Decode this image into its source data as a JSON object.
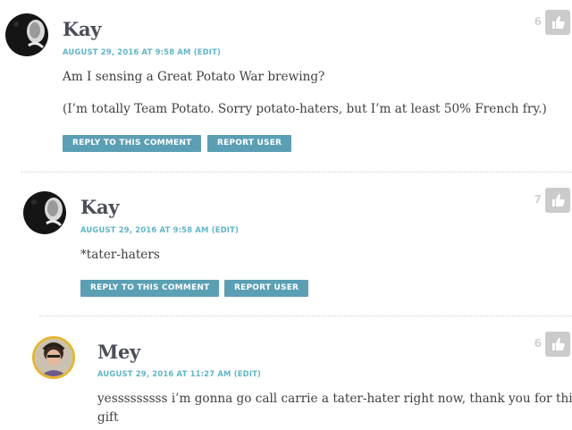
{
  "comments": [
    {
      "author": "Kay",
      "date": "AUGUST 29, 2016 AT 9:58 AM",
      "edit": "(EDIT)",
      "paragraphs": [
        "Am I sensing a Great Potato War brewing?",
        "(I’m totally Team Potato. Sorry potato-haters, but I’m at least 50% French fry.)"
      ],
      "reply_label": "REPLY TO THIS COMMENT",
      "report_label": "REPORT USER",
      "votes": "6"
    },
    {
      "author": "Kay",
      "date": "AUGUST 29, 2016 AT 9:58 AM",
      "edit": "(EDIT)",
      "paragraphs": [
        "*tater-haters"
      ],
      "reply_label": "REPLY TO THIS COMMENT",
      "report_label": "REPORT USER",
      "votes": "7"
    },
    {
      "author": "Mey",
      "date": "AUGUST 29, 2016 AT 11:27 AM",
      "edit": "(EDIT)",
      "paragraphs": [
        "yesssssssss i’m gonna go call carrie a tater-hater right now, thank you for this",
        "gift"
      ],
      "votes": "6"
    }
  ],
  "colors": {
    "accent": "#5fb6c8",
    "button": "#5b9fb5",
    "thumb": "#cbcbcb"
  },
  "icons": {
    "vote": "thumbs-up-icon"
  }
}
